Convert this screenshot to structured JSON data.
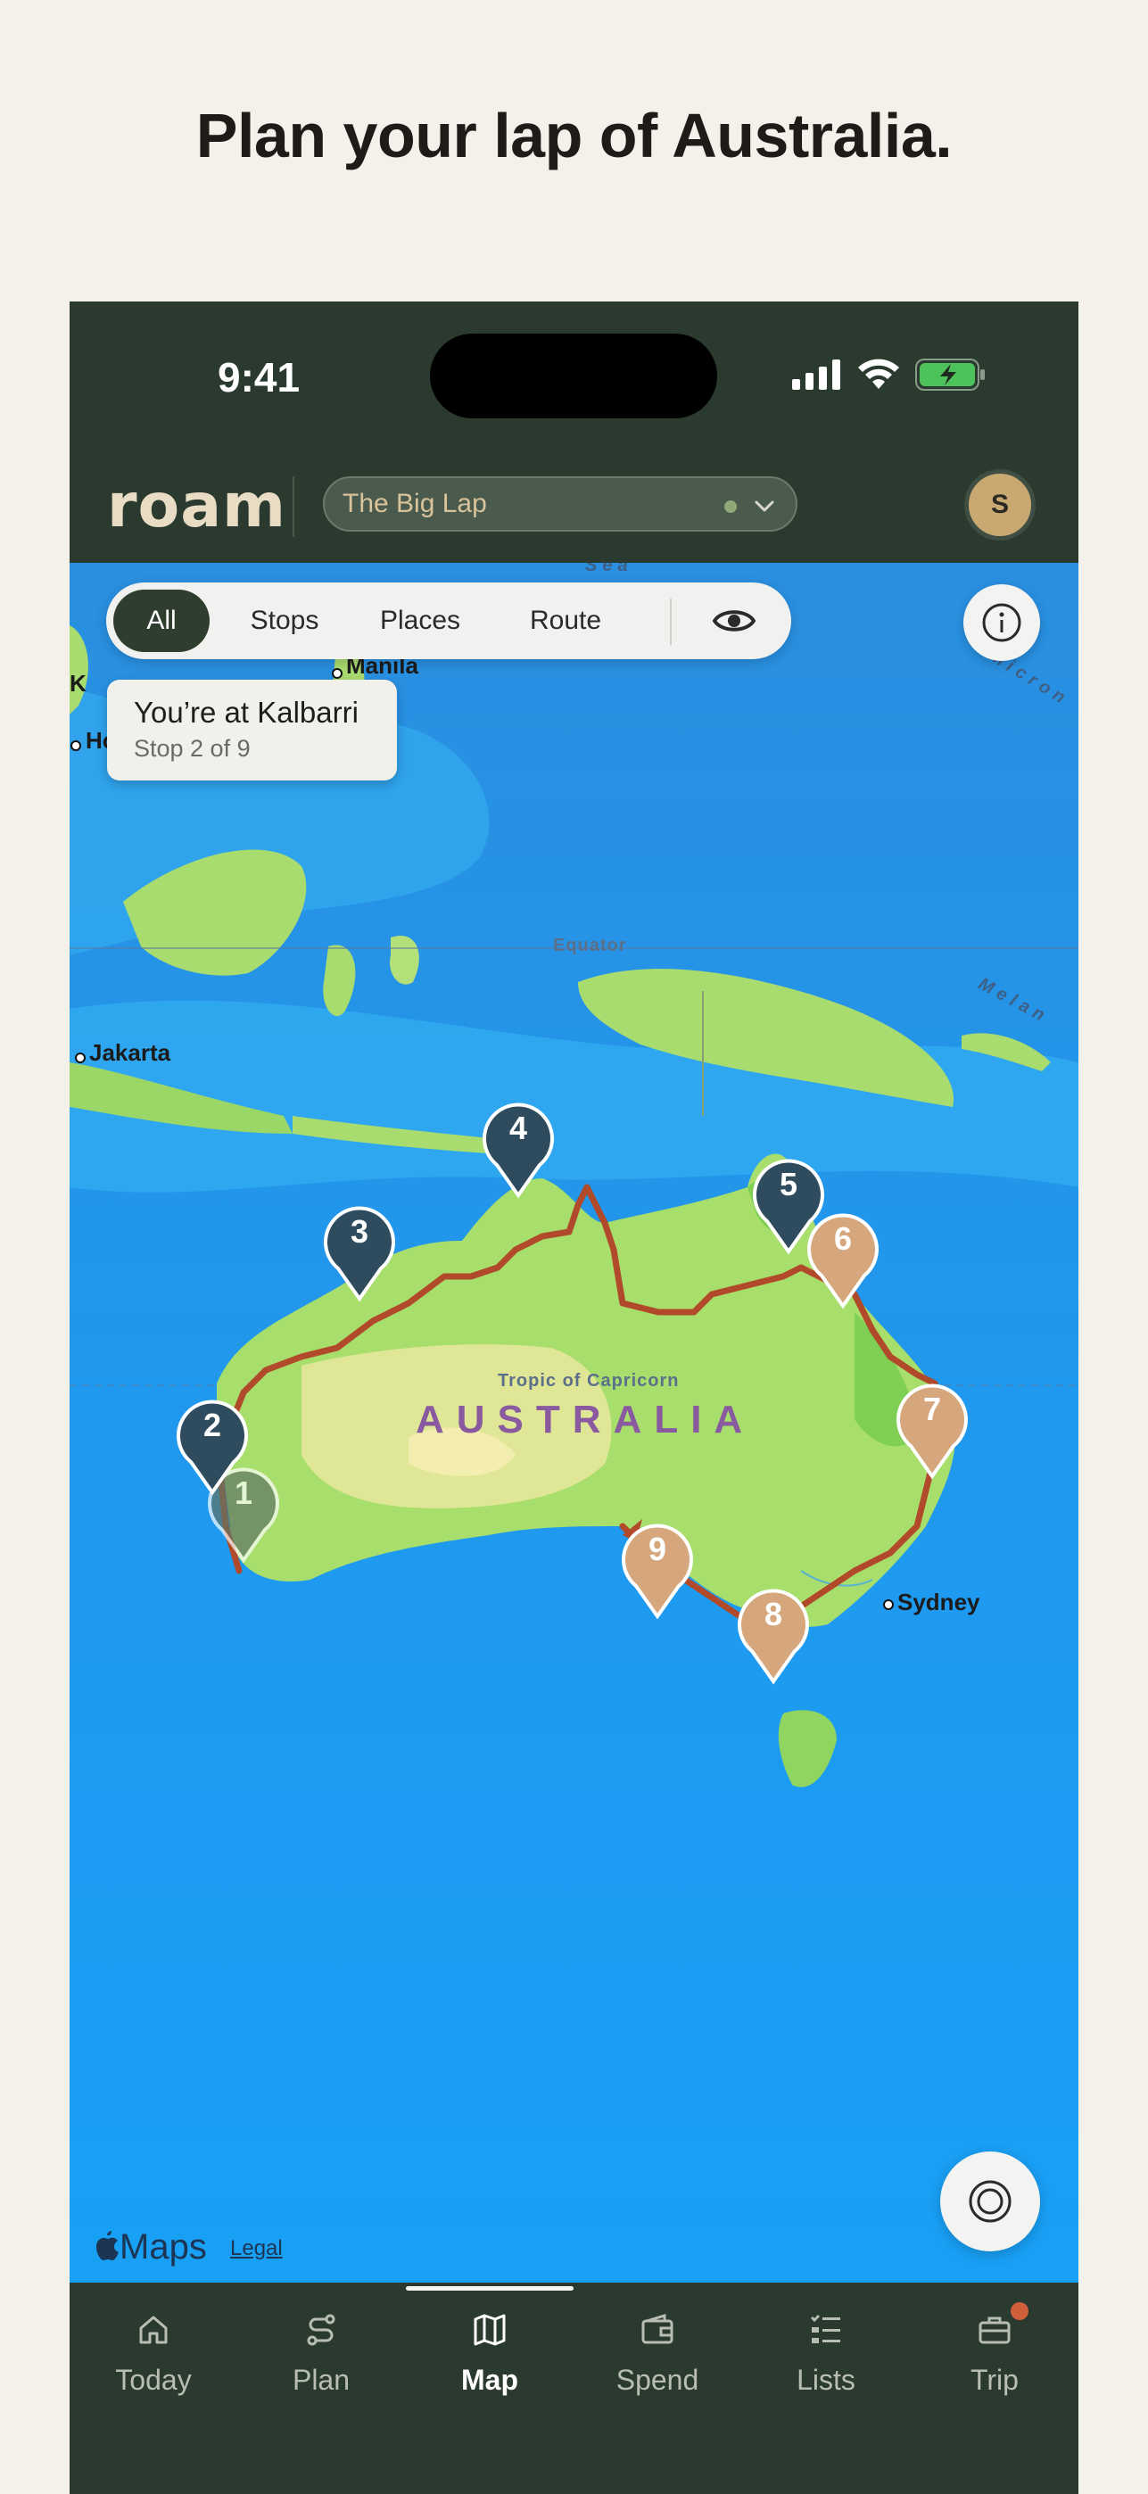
{
  "headline": "Plan your lap of Australia.",
  "status_bar": {
    "time": "9:41",
    "battery_state": "charging"
  },
  "header": {
    "logo": "roam",
    "trip_selector": {
      "value": "The Big Lap",
      "status_color": "#8fa877"
    },
    "avatar_initial": "S"
  },
  "filters": {
    "chips": [
      {
        "label": "All",
        "active": true
      },
      {
        "label": "Stops",
        "active": false
      },
      {
        "label": "Places",
        "active": false
      },
      {
        "label": "Route",
        "active": false
      }
    ],
    "visibility_icon": "eye-icon"
  },
  "info_icon": "info-icon",
  "toast": {
    "title": "You’re at Kalbarri",
    "subtitle": "Stop 2 of 9"
  },
  "map": {
    "labels": {
      "sea": "Sea",
      "manila": "Manila",
      "jakarta": "Jakarta",
      "equator": "Equator",
      "tropic": "Tropic of Capricorn",
      "country": "AUSTRALIA",
      "sydney": "Sydney",
      "micronesia_fragment": "Micron",
      "melanesia_fragment": "Melan",
      "edge_fragment_k": "K",
      "edge_fragment_ho": "Ho"
    },
    "stops": [
      {
        "number": "1",
        "state": "visited",
        "color": "#5f7566"
      },
      {
        "number": "2",
        "state": "current",
        "color": "#2f4c5e"
      },
      {
        "number": "3",
        "state": "planned",
        "color": "#2f4c5e"
      },
      {
        "number": "4",
        "state": "planned",
        "color": "#2f4c5e"
      },
      {
        "number": "5",
        "state": "planned",
        "color": "#2f4c5e"
      },
      {
        "number": "6",
        "state": "upcoming",
        "color": "#d6a77c"
      },
      {
        "number": "7",
        "state": "upcoming",
        "color": "#d6a77c"
      },
      {
        "number": "8",
        "state": "upcoming",
        "color": "#d6a77c"
      },
      {
        "number": "9",
        "state": "upcoming",
        "color": "#d6a77c"
      }
    ],
    "route_color": "#b04a2a",
    "attribution": "Maps",
    "legal": "Legal",
    "locate_icon": "locate-icon"
  },
  "tabs": [
    {
      "label": "Today",
      "icon": "home-icon",
      "active": false
    },
    {
      "label": "Plan",
      "icon": "route-icon",
      "active": false
    },
    {
      "label": "Map",
      "icon": "map-icon",
      "active": true
    },
    {
      "label": "Spend",
      "icon": "wallet-icon",
      "active": false
    },
    {
      "label": "Lists",
      "icon": "list-icon",
      "active": false
    },
    {
      "label": "Trip",
      "icon": "briefcase-icon",
      "active": false,
      "badge": true
    }
  ]
}
